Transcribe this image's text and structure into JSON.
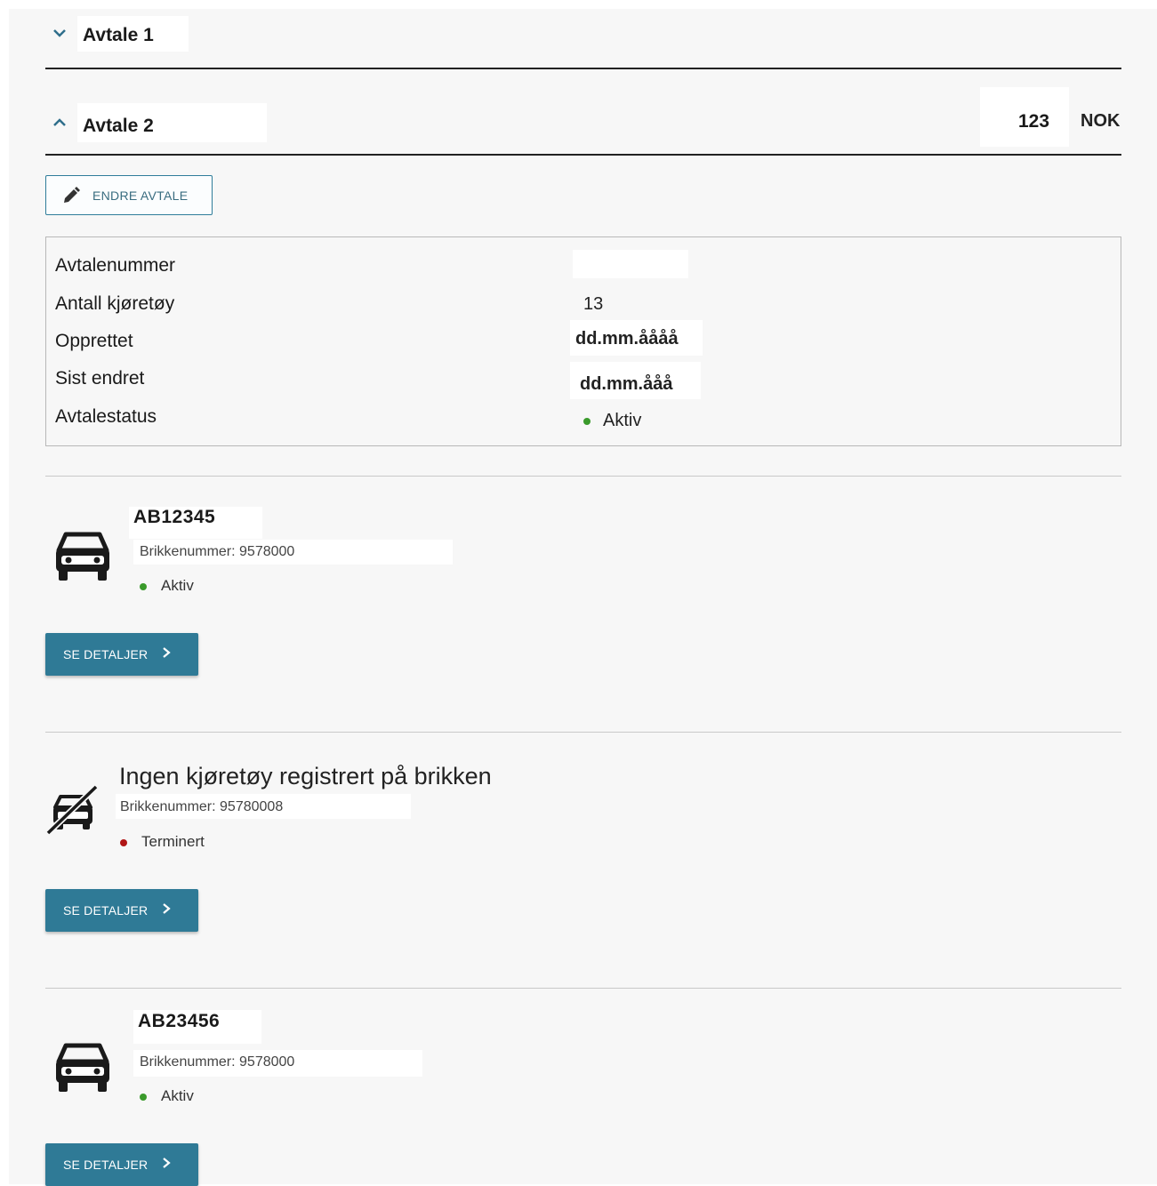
{
  "accordion": {
    "item1": {
      "title": "Avtale 1",
      "expanded": false
    },
    "item2": {
      "title": "Avtale 2",
      "expanded": true,
      "amount": "123",
      "currency": "NOK"
    }
  },
  "toolbar": {
    "edit_label": "ENDRE AVTALE"
  },
  "agreement": {
    "rows": [
      {
        "label": "Avtalenummer",
        "value": ""
      },
      {
        "label": "Antall kjøretøy",
        "value": "13"
      },
      {
        "label": "Opprettet",
        "value": "dd.mm.åååå"
      },
      {
        "label": "Sist endret",
        "value": "dd.mm.ååå"
      },
      {
        "label": "Avtalestatus",
        "value": "Aktiv"
      }
    ]
  },
  "vehicles": [
    {
      "plate": "AB12345",
      "chip": "Brikkenummer: 9578000",
      "status": "Aktiv",
      "details_label": "SE DETALJER"
    },
    {
      "title": "Ingen kjøretøy registrert på brikken",
      "chip": "Brikkenummer: 95780008",
      "status": "Terminert",
      "details_label": "SE DETALJER"
    },
    {
      "plate": "AB23456",
      "chip": "Brikkenummer: 9578000",
      "status": "Aktiv",
      "details_label": "SE DETALJER"
    }
  ],
  "colors": {
    "accent": "#2f7a96",
    "status_active": "#3a9a2b",
    "status_terminated": "#b01616"
  },
  "icons": [
    "chevron-down-icon",
    "chevron-up-icon",
    "pencil-icon",
    "car-icon",
    "car-off-icon",
    "chevron-right-icon"
  ]
}
